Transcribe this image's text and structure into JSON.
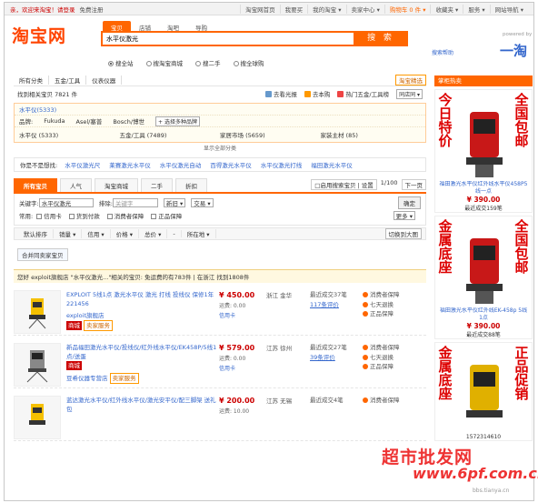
{
  "topbar": {
    "welcome": "亲，欢迎来淘宝！请登录",
    "register": "免费注册",
    "links": [
      "淘宝网首页",
      "我要买",
      "我的淘宝 ▾",
      "卖家中心 ▾",
      "购物车 0 件 ▾",
      "收藏夹 ▾",
      "服务 ▾",
      "网站导航 ▾"
    ]
  },
  "header": {
    "logo": "淘宝网",
    "search_tabs": [
      "宝贝",
      "店铺",
      "淘吧",
      "导购"
    ],
    "search_value": "水平仪激光",
    "search_button": "搜 索",
    "help": "搜索帮助",
    "alogo_sub": "powered by",
    "alogo": "一淘",
    "radios": [
      "搜全站",
      "搜淘宝商城",
      "搜二手",
      "搜全球购"
    ]
  },
  "crumbs": [
    "所有分类",
    "五金/工具",
    "仪表仪器"
  ],
  "bulk": "淘宝精选",
  "found": {
    "text": "找到相关宝贝 7821 件",
    "actions": [
      "去看光报",
      "去本购",
      "热门五金/工具榜"
    ],
    "select": "同店同 ▾"
  },
  "catbox": {
    "root": "水平仪(5333)",
    "brand_label": "品牌:",
    "brands": [
      "Fukuda",
      "Asel/塞普",
      "Bosch/博世"
    ],
    "more_brands": "+ 选择多种品牌",
    "cats": [
      "水平仪 (5333)",
      "五金/工具 (7489)",
      "家居市场 (5659)",
      "家装主材 (85)"
    ],
    "more": "显示全部分类"
  },
  "suggest": {
    "label": "你是不是想找:",
    "items": [
      "水平仪激光尺",
      "莱赛激光水平仪",
      "水平仪激光自动",
      "百得激光水平仪",
      "水平仪激光打线",
      "福田激光水平仪"
    ]
  },
  "tabs": [
    "所有宝贝",
    "人气",
    "淘宝商城",
    "二手",
    "折扣"
  ],
  "tabs_right": {
    "ship": "□启用搜索宝贝 | 设置",
    "page": "1/100",
    "next": "下一页"
  },
  "filters": {
    "kw_label": "关键字:",
    "kw_value": "水平仪激光",
    "exclude_label": "排除:",
    "exclude_placeholder": "关键字",
    "new": "新旧 ▾",
    "trade": "交易 ▾",
    "ok": "确定",
    "common_label": "常用:",
    "checks": [
      "信用卡",
      "货到付款",
      "消费者保障",
      "正品保障"
    ],
    "more": "更多 ▾"
  },
  "sortbar": {
    "items": [
      "默认排序",
      "销量 ▾",
      "信用 ▾",
      "价格 ▾",
      "总价 ▾",
      "-",
      "所在地 ▾"
    ],
    "switch": "切换到大图"
  },
  "merge": "合并同卖家宝贝",
  "notice": "您好 exploit旗舰店 \"水平仪激光...\"相关的宝贝: 免运费的有783件 | 在浙江 找到1808件",
  "items": [
    {
      "title": "EXPLOIT 5线1点 激光水平仪 激光 打线 投线仪 保修1年 221456",
      "shop": "exploit旗舰店",
      "tag": "商城",
      "tag2": "卖家服务",
      "price": "¥ 450.00",
      "ship": "运费: 0.00",
      "card": "信用卡",
      "loc": "浙江 金华",
      "sold": "最近成交37笔",
      "reviews": "117条评价",
      "svcs": [
        "消费者保障",
        "七天退换",
        "正品保障"
      ]
    },
    {
      "title": "新品福田激光水平仪/投线仪/红外线水平仪/EK458P/5线1点/送蛋",
      "shop": "豆希仪器专营店",
      "tag": "商城",
      "tag2": "卖家服务",
      "price": "¥ 579.00",
      "ship": "运费: 0.00",
      "card": "信用卡",
      "loc": "江苏 徐州",
      "sold": "最近成交27笔",
      "reviews": "39条评价",
      "svcs": [
        "消费者保障",
        "七天退换",
        "正品保障"
      ]
    },
    {
      "title": "蓝达激光水平仪/红外线水平仪/激光安平仪/配三脚架 送礼包",
      "shop": "",
      "tag": "",
      "tag2": "",
      "price": "¥ 200.00",
      "ship": "运费: 10.00",
      "card": "",
      "loc": "江苏 无锡",
      "sold": "最近成交4笔",
      "reviews": "",
      "svcs": [
        "消费者保障"
      ]
    }
  ],
  "side": {
    "header": "掌柜热卖",
    "ads": [
      {
        "words_l": "今日特价",
        "words_r": "全国包邮",
        "title": "福田激光水平仪红外线水平仪458P5线一点",
        "price": "¥ 390.00",
        "sold": "最近成交159笔"
      },
      {
        "words_l": "金属底座",
        "words_r": "全国包邮",
        "title": "福田激光水平仪红外线EK-458p 5线1点",
        "price": "¥ 390.00",
        "sold": "最近成交88笔"
      },
      {
        "words_l": "金属底座",
        "words_r": "正品促销",
        "title": "",
        "price": "",
        "sold": "1572314610"
      }
    ]
  },
  "watermark": {
    "a": "超市批发网",
    "b": "www.6pf.com.cn",
    "c": "bbs.tianya.cn"
  },
  "colors": {
    "accent": "#ff6600",
    "link": "#3366cc",
    "price": "#cc0000"
  }
}
